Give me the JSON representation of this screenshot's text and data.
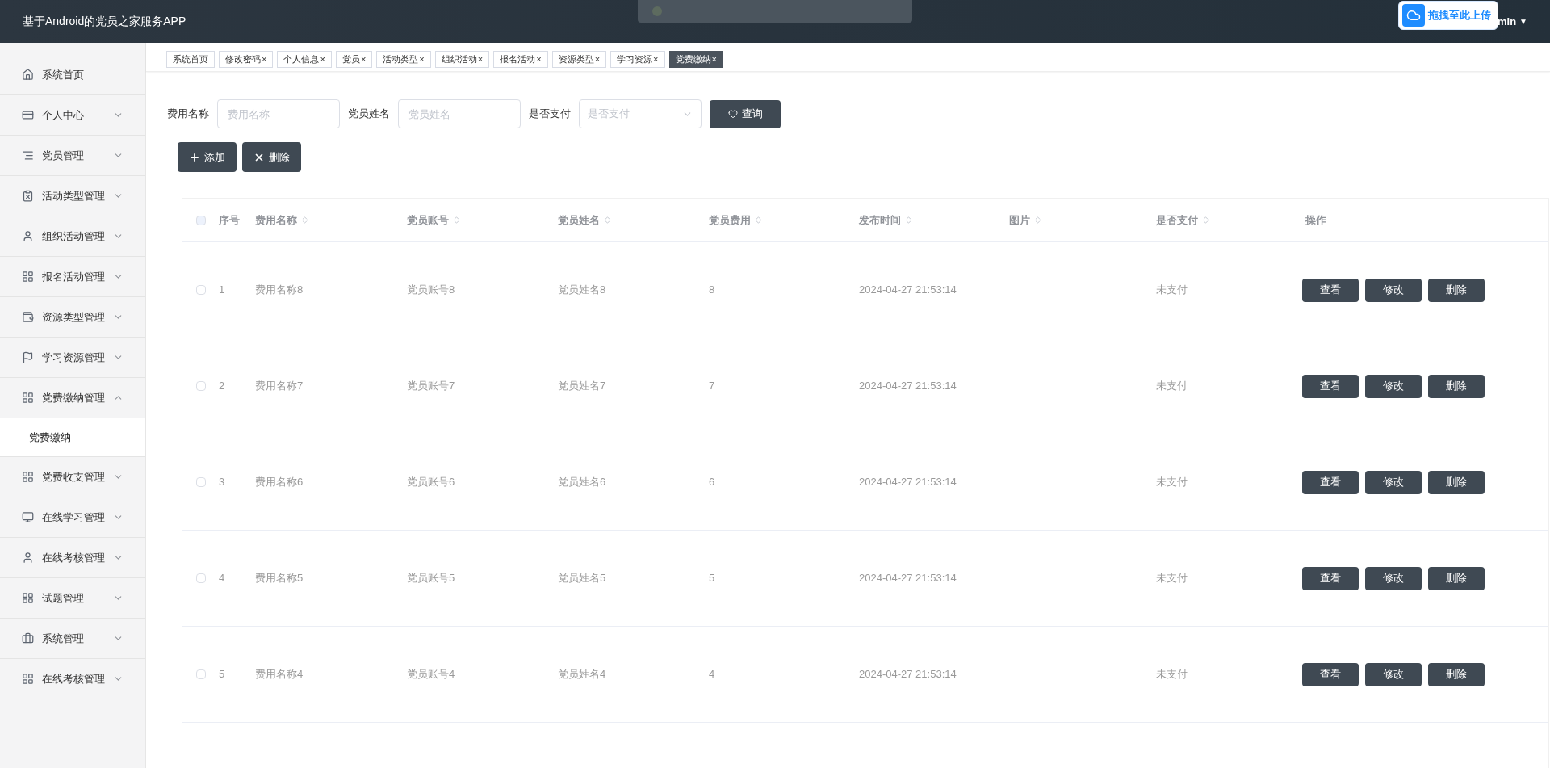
{
  "header": {
    "title": "基于Android的党员之家服务APP",
    "user": "min",
    "caret": "▼",
    "upload_badge": "拖拽至此上传"
  },
  "sidebar": {
    "items": [
      {
        "label": "系统首页",
        "expandable": false
      },
      {
        "label": "个人中心",
        "expandable": true,
        "expanded": false
      },
      {
        "label": "党员管理",
        "expandable": true,
        "expanded": false
      },
      {
        "label": "活动类型管理",
        "expandable": true,
        "expanded": false
      },
      {
        "label": "组织活动管理",
        "expandable": true,
        "expanded": false
      },
      {
        "label": "报名活动管理",
        "expandable": true,
        "expanded": false
      },
      {
        "label": "资源类型管理",
        "expandable": true,
        "expanded": false
      },
      {
        "label": "学习资源管理",
        "expandable": true,
        "expanded": false
      },
      {
        "label": "党费缴纳管理",
        "expandable": true,
        "expanded": true,
        "children": [
          {
            "label": "党费缴纳",
            "selected": true
          }
        ]
      },
      {
        "label": "党费收支管理",
        "expandable": true,
        "expanded": false
      },
      {
        "label": "在线学习管理",
        "expandable": true,
        "expanded": false
      },
      {
        "label": "在线考核管理",
        "expandable": true,
        "expanded": false
      },
      {
        "label": "试题管理",
        "expandable": true,
        "expanded": false
      },
      {
        "label": "系统管理",
        "expandable": true,
        "expanded": false
      },
      {
        "label": "在线考核管理",
        "expandable": true,
        "expanded": false
      }
    ]
  },
  "tabs": [
    {
      "label": "系统首页",
      "selected": false
    },
    {
      "label": "修改密码",
      "close": "×",
      "selected": false
    },
    {
      "label": "个人信息",
      "close": "×",
      "selected": false
    },
    {
      "label": "党员",
      "close": "×",
      "selected": false
    },
    {
      "label": "活动类型",
      "close": "×",
      "selected": false
    },
    {
      "label": "组织活动",
      "close": "×",
      "selected": false
    },
    {
      "label": "报名活动",
      "close": "×",
      "selected": false
    },
    {
      "label": "资源类型",
      "close": "×",
      "selected": false
    },
    {
      "label": "学习资源",
      "close": "×",
      "selected": false
    },
    {
      "label": "党费缴纳",
      "close": "×",
      "selected": true
    }
  ],
  "search": {
    "fields": [
      {
        "label": "费用名称",
        "placeholder": "费用名称",
        "kind": "input"
      },
      {
        "label": "党员姓名",
        "placeholder": "党员姓名",
        "kind": "input"
      },
      {
        "label": "是否支付",
        "placeholder": "是否支付",
        "kind": "select"
      }
    ],
    "button": "查询"
  },
  "actions": [
    "添加",
    "删除"
  ],
  "table": {
    "all_checked": false,
    "columns": [
      {
        "label": "序号",
        "sortable": false
      },
      {
        "label": "费用名称",
        "sortable": true
      },
      {
        "label": "党员账号",
        "sortable": true
      },
      {
        "label": "党员姓名",
        "sortable": true
      },
      {
        "label": "党员费用",
        "sortable": true
      },
      {
        "label": "发布时间",
        "sortable": true
      },
      {
        "label": "图片",
        "sortable": true
      },
      {
        "label": "是否支付",
        "sortable": true
      },
      {
        "label": "操作",
        "sortable": false
      }
    ],
    "rows": [
      {
        "checked": false,
        "cells": [
          "1",
          "费用名称8",
          "党员账号8",
          "党员姓名8",
          "8",
          "2024-04-27 21:53:14",
          "",
          "未支付"
        ],
        "buttons": [
          "查看",
          "修改",
          "删除"
        ]
      },
      {
        "checked": false,
        "cells": [
          "2",
          "费用名称7",
          "党员账号7",
          "党员姓名7",
          "7",
          "2024-04-27 21:53:14",
          "",
          "未支付"
        ],
        "buttons": [
          "查看",
          "修改",
          "删除"
        ]
      },
      {
        "checked": false,
        "cells": [
          "3",
          "费用名称6",
          "党员账号6",
          "党员姓名6",
          "6",
          "2024-04-27 21:53:14",
          "",
          "未支付"
        ],
        "buttons": [
          "查看",
          "修改",
          "删除"
        ]
      },
      {
        "checked": false,
        "cells": [
          "4",
          "费用名称5",
          "党员账号5",
          "党员姓名5",
          "5",
          "2024-04-27 21:53:14",
          "",
          "未支付"
        ],
        "buttons": [
          "查看",
          "修改",
          "删除"
        ]
      },
      {
        "checked": false,
        "cells": [
          "5",
          "费用名称4",
          "党员账号4",
          "党员姓名4",
          "4",
          "2024-04-27 21:53:14",
          "",
          "未支付"
        ],
        "buttons": [
          "查看",
          "修改",
          "删除"
        ]
      }
    ]
  }
}
